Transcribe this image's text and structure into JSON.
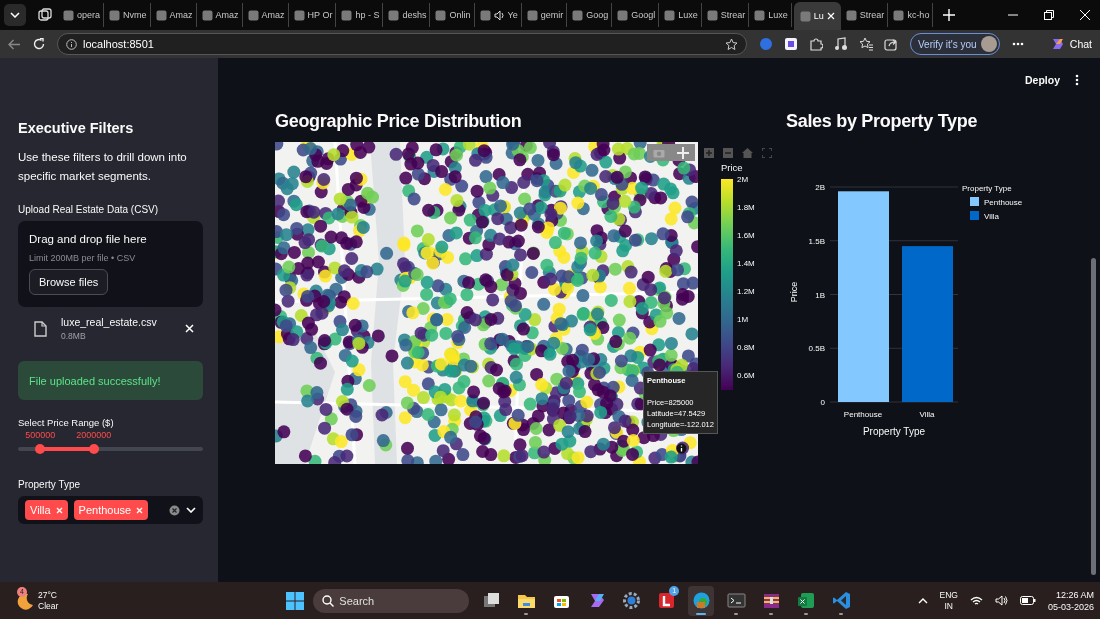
{
  "browser": {
    "tabs": [
      {
        "title": "opera",
        "selected": false,
        "audio": false
      },
      {
        "title": "Nvme",
        "selected": false,
        "audio": false
      },
      {
        "title": "Amaz",
        "selected": false,
        "audio": false
      },
      {
        "title": "Amaz",
        "selected": false,
        "audio": false
      },
      {
        "title": "Amaz",
        "selected": false,
        "audio": false
      },
      {
        "title": "HP Or",
        "selected": false,
        "audio": false
      },
      {
        "title": "hp - S",
        "selected": false,
        "audio": false
      },
      {
        "title": "deshs",
        "selected": false,
        "audio": false
      },
      {
        "title": "Onlin",
        "selected": false,
        "audio": false
      },
      {
        "title": "Ye",
        "selected": false,
        "audio": true
      },
      {
        "title": "gemir",
        "selected": false,
        "audio": false
      },
      {
        "title": "Goog",
        "selected": false,
        "audio": false
      },
      {
        "title": "Googl",
        "selected": false,
        "audio": false
      },
      {
        "title": "Luxe",
        "selected": false,
        "audio": false
      },
      {
        "title": "Strear",
        "selected": false,
        "audio": false
      },
      {
        "title": "Luxe",
        "selected": false,
        "audio": false
      },
      {
        "title": "Lu",
        "selected": true,
        "audio": false
      },
      {
        "title": "Strear",
        "selected": false,
        "audio": false
      },
      {
        "title": "kc-ho",
        "selected": false,
        "audio": false
      }
    ],
    "address": "localhost:8501",
    "profile_button": "Verify it's you",
    "chat_button": "Chat"
  },
  "app": {
    "header": {
      "deploy_button": "Deploy"
    },
    "sidebar": {
      "title": "Executive Filters",
      "description": "Use these filters to drill down into specific market segments.",
      "uploader": {
        "label": "Upload Real Estate Data (CSV)",
        "prompt": "Drag and drop file here",
        "limit": "Limit 200MB per file • CSV",
        "button": "Browse files",
        "file": {
          "name": "luxe_real_estate.csv",
          "size": "0.8MB"
        }
      },
      "alert": "File uploaded successfully!",
      "price_slider": {
        "label": "Select Price Range ($)",
        "thumbs": [
          {
            "reading": "500000",
            "level": 0.12
          },
          {
            "reading": "2000000",
            "level": 0.41
          }
        ]
      },
      "property_type": {
        "label": "Property Type",
        "tags": [
          "Villa",
          "Penthouse"
        ]
      }
    },
    "map_panel": {
      "title": "Geographic Price Distribution",
      "tooltip": {
        "heading": "Penthouse",
        "lines": [
          "Price=825000",
          "Latitude=47.5429",
          "Longitude=-122.012"
        ]
      },
      "colorbar": {
        "title": "Price",
        "ticks": [
          "2M",
          "1.8M",
          "1.6M",
          "1.4M",
          "1.2M",
          "1M",
          "0.8M",
          "0.6M"
        ]
      }
    },
    "bar_panel": {
      "title": "Sales by Property Type",
      "chart_data": {
        "type": "bar",
        "xlabel": "Property Type",
        "ylabel": "Price",
        "categories": [
          "Penthouse",
          "Villa"
        ],
        "grid": true,
        "legend": {
          "title": "Property Type"
        },
        "series": [
          {
            "name": "Penthouse",
            "color": "#83c9ff",
            "values": [
              1960000000,
              null
            ]
          },
          {
            "name": "Villa",
            "color": "#0068c9",
            "values": [
              null,
              1450000000
            ]
          }
        ],
        "ylim": [
          0,
          2000000000
        ],
        "yticks": [
          {
            "value": 0,
            "label": "0"
          },
          {
            "value": 500000000,
            "label": "0.5B"
          },
          {
            "value": 1000000000,
            "label": "1B"
          },
          {
            "value": 1500000000,
            "label": "1.5B"
          },
          {
            "value": 2000000000,
            "label": "2B"
          }
        ]
      }
    }
  },
  "taskbar": {
    "weather": {
      "temperature": "27°C",
      "condition": "Clear",
      "badge": "4"
    },
    "search": {
      "placeholder": "Search"
    },
    "apps": [
      {
        "running": false,
        "selected": false
      },
      {
        "running": true,
        "selected": false
      },
      {
        "running": false,
        "selected": false
      },
      {
        "running": false,
        "selected": false
      },
      {
        "running": false,
        "selected": false
      },
      {
        "running": false,
        "selected": false,
        "badge": "1"
      },
      {
        "running": true,
        "selected": true
      },
      {
        "running": true,
        "selected": false
      },
      {
        "running": true,
        "selected": false
      },
      {
        "running": true,
        "selected": false
      },
      {
        "running": true,
        "selected": false
      }
    ],
    "language": "ENG",
    "region": "IN",
    "time": "12:26 AM",
    "date": "05-03-2026"
  }
}
